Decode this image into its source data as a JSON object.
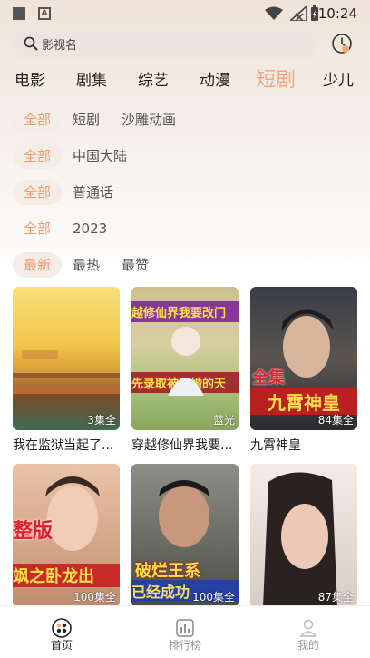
{
  "status": {
    "time": "10:24",
    "notif_icon": "A"
  },
  "search": {
    "placeholder": "影视名"
  },
  "categories": [
    "电影",
    "剧集",
    "综艺",
    "动漫",
    "短剧",
    "少儿"
  ],
  "active_category": "短剧",
  "filters": [
    {
      "options": [
        "全部",
        "短剧",
        "沙雕动画"
      ],
      "selected": "全部"
    },
    {
      "options": [
        "全部",
        "中国大陆"
      ],
      "selected": "全部"
    },
    {
      "options": [
        "全部",
        "普通话"
      ],
      "selected": "全部"
    },
    {
      "options": [
        "全部",
        "2023"
      ],
      "selected": "全部"
    },
    {
      "options": [
        "最新",
        "最热",
        "最赞"
      ],
      "selected": "最新"
    }
  ],
  "cards": [
    {
      "title": "我在监狱当起了...",
      "badge": "3集全",
      "poster_text": ""
    },
    {
      "title": "穿越修仙界我要...",
      "badge": "蓝光",
      "poster_text_1": "越修仙界我要改门",
      "poster_text_2": "先录取被退婚的天"
    },
    {
      "title": "九霄神皇",
      "badge": "84集全",
      "poster_text_1": "全集",
      "poster_text_2": "九霄神皇"
    },
    {
      "title": "",
      "badge": "100集全",
      "poster_text_1": "整版",
      "poster_text_2": "飒之卧龙出"
    },
    {
      "title": "",
      "badge": "100集全",
      "poster_text_1": "破烂王系",
      "poster_text_2": "已经成功"
    },
    {
      "title": "",
      "badge": "87集全",
      "poster_text": ""
    }
  ],
  "tabbar": [
    {
      "label": "首页",
      "icon": "home-icon",
      "active": true
    },
    {
      "label": "排行榜",
      "icon": "ranking-icon",
      "active": false
    },
    {
      "label": "我的",
      "icon": "profile-icon",
      "active": false
    }
  ],
  "colors": {
    "accent": "#f6a67c",
    "chip_bg": "#f3ece7"
  }
}
